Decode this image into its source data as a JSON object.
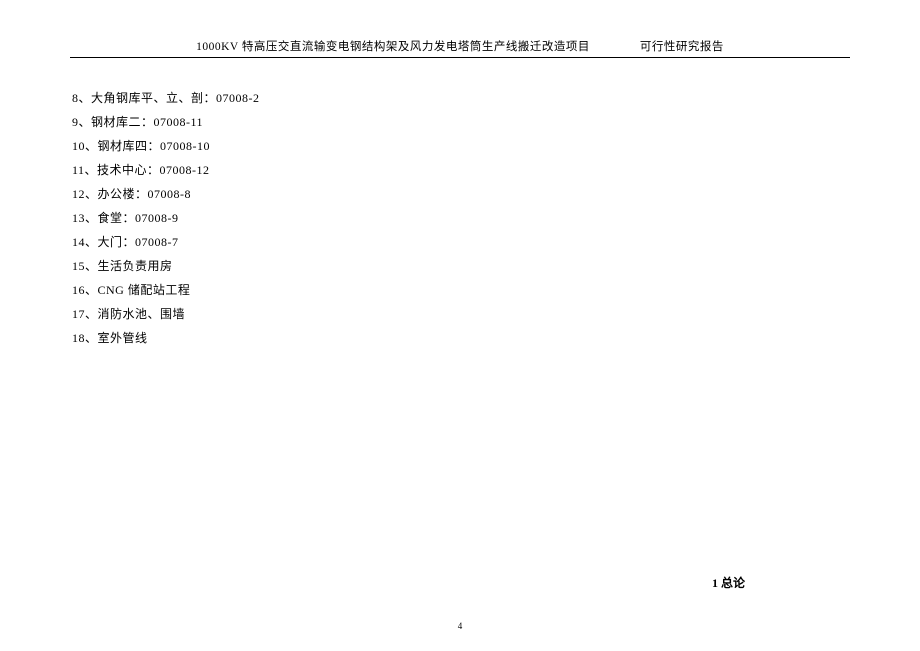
{
  "header": {
    "title": "1000KV 特高压交直流输变电钢结构架及风力发电塔筒生产线搬迁改造项目",
    "subtitle": "可行性研究报告"
  },
  "items": [
    "8、大角钢库平、立、剖：07008-2",
    "9、钢材库二：07008-11",
    "10、钢材库四：07008-10",
    "11、技术中心：07008-12",
    "12、办公楼：07008-8",
    "13、食堂：07008-9",
    "14、大门：07008-7",
    "15、生活负责用房",
    "16、CNG 储配站工程",
    "17、消防水池、围墙",
    "18、室外管线"
  ],
  "section_heading": "1 总论",
  "page_number": "4"
}
